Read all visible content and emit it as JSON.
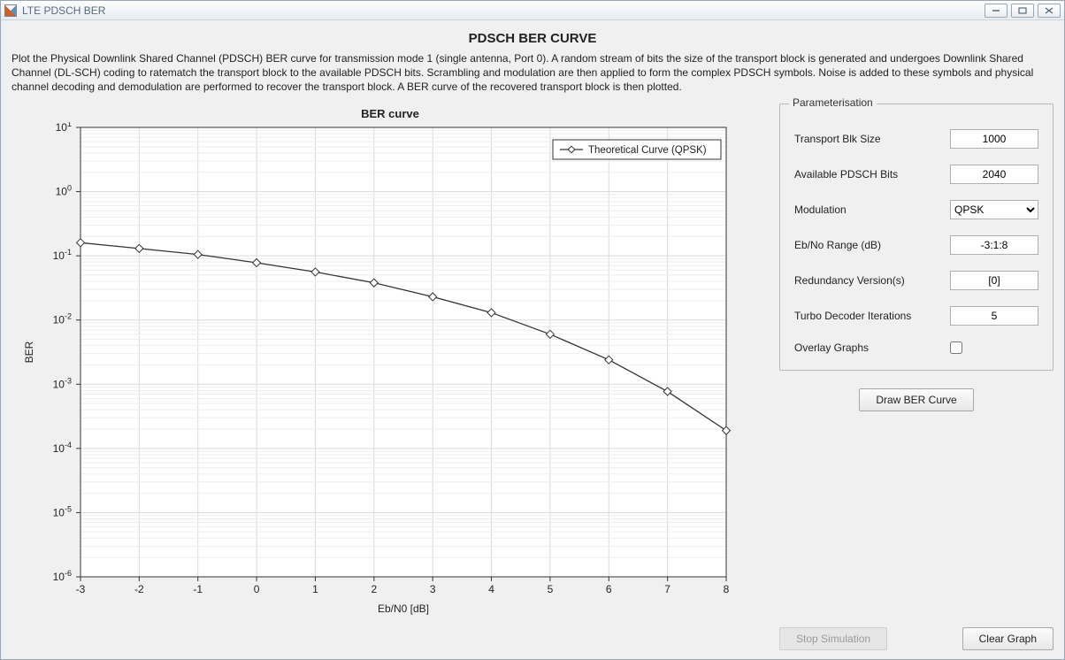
{
  "window": {
    "title": "LTE PDSCH BER",
    "min": "—",
    "max": "□",
    "close": "✕"
  },
  "header": {
    "page_title": "PDSCH BER CURVE",
    "description": "Plot the Physical Downlink Shared Channel (PDSCH) BER curve for transmission mode 1 (single antenna, Port 0). A random stream of bits the size of the transport block is generated and undergoes Downlink Shared Channel (DL-SCH) coding to ratematch the transport block to the available PDSCH bits. Scrambling and modulation are then applied to form the complex PDSCH symbols. Noise is added to these symbols and physical channel decoding and demodulation are performed to recover the transport block. A BER curve of the recovered transport block is then plotted."
  },
  "chart": {
    "title": "BER curve",
    "xlabel": "Eb/N0 [dB]",
    "ylabel": "BER",
    "legend_entry": "Theoretical Curve (QPSK)",
    "xticks": [
      "-3",
      "-2",
      "-1",
      "0",
      "1",
      "2",
      "3",
      "4",
      "5",
      "6",
      "7",
      "8"
    ],
    "ytick_exp_labels": [
      "1",
      "0",
      "-1",
      "-2",
      "-3",
      "-4",
      "-5",
      "-6"
    ]
  },
  "chart_data": {
    "type": "line",
    "title": "BER curve",
    "xlabel": "Eb/N0 [dB]",
    "ylabel": "BER",
    "xlim": [
      -3,
      8
    ],
    "ylim": [
      1e-06,
      10
    ],
    "yscale": "log",
    "grid": true,
    "legend": {
      "position": "top-right"
    },
    "series": [
      {
        "name": "Theoretical Curve (QPSK)",
        "marker": "diamond",
        "x": [
          -3,
          -2,
          -1,
          0,
          1,
          2,
          3,
          4,
          5,
          6,
          7,
          8
        ],
        "y": [
          0.16,
          0.13,
          0.105,
          0.078,
          0.056,
          0.038,
          0.023,
          0.013,
          0.006,
          0.0024,
          0.00077,
          0.00019
        ]
      }
    ]
  },
  "params": {
    "fieldset_title": "Parameterisation",
    "transport_blk_size": {
      "label": "Transport Blk Size",
      "value": "1000"
    },
    "available_pdsch_bits": {
      "label": "Available PDSCH Bits",
      "value": "2040"
    },
    "modulation": {
      "label": "Modulation",
      "value": "QPSK"
    },
    "ebno_range": {
      "label": "Eb/No Range (dB)",
      "value": "-3:1:8"
    },
    "redundancy_versions": {
      "label": "Redundancy Version(s)",
      "value": "[0]"
    },
    "turbo_iter": {
      "label": "Turbo Decoder Iterations",
      "value": "5"
    },
    "overlay": {
      "label": "Overlay Graphs",
      "checked": false
    }
  },
  "buttons": {
    "draw": "Draw BER Curve",
    "stop": "Stop Simulation",
    "clear": "Clear Graph"
  }
}
